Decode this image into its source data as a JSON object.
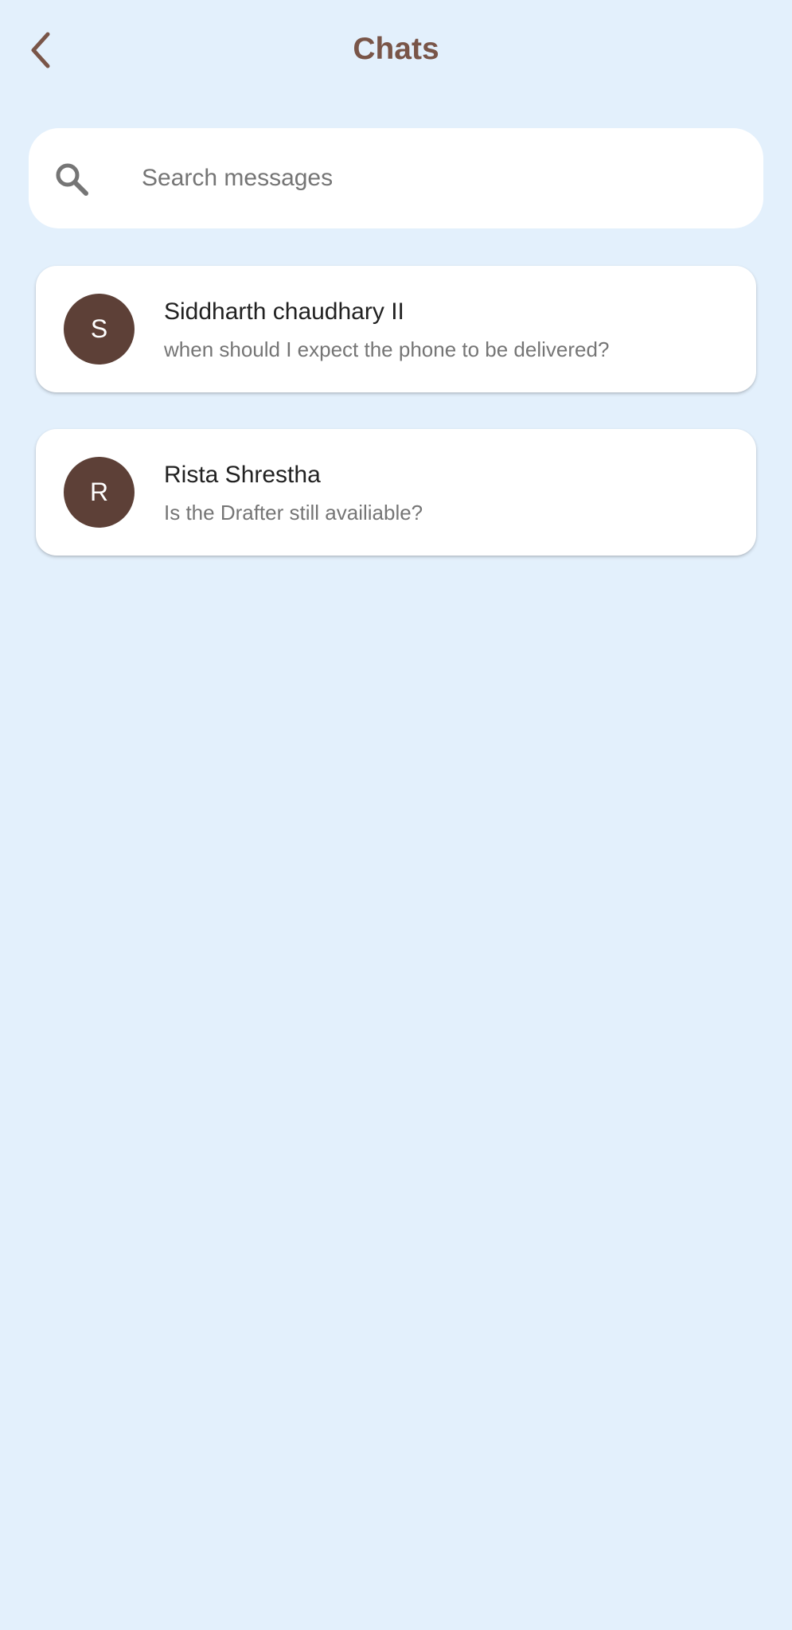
{
  "header": {
    "title": "Chats",
    "back_icon": "chevron-left-icon"
  },
  "search": {
    "placeholder": "Search messages",
    "value": "",
    "icon": "search-icon"
  },
  "chats": [
    {
      "initial": "S",
      "name": "Siddharth chaudhary II",
      "last_message": "when should I expect the phone to be delivered?"
    },
    {
      "initial": "R",
      "name": "Rista Shrestha",
      "last_message": "Is the Drafter still availiable?"
    }
  ],
  "colors": {
    "background": "#e3f0fc",
    "accent": "#795548",
    "avatar": "#5d4037",
    "card": "#ffffff"
  }
}
